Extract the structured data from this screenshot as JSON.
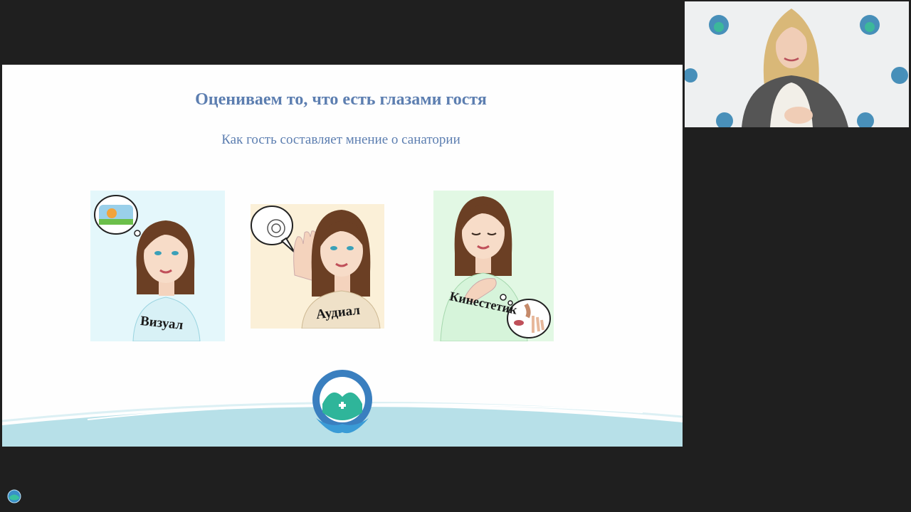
{
  "slide": {
    "title": "Оцениваем то, что есть глазами гостя",
    "subtitle": "Как гость составляет мнение о санатории",
    "cards": [
      {
        "label": "Визуал",
        "bg": "#e4f7fb"
      },
      {
        "label": "Аудиал",
        "bg": "#fbf0d8"
      },
      {
        "label": "Кинестетик",
        "bg": "#e2f8e4"
      }
    ]
  },
  "colors": {
    "title": "#5c7eb0",
    "wave": "#b7e0e8",
    "logo_ring": "#3a7fbf",
    "logo_green": "#2fb59a"
  },
  "icons": {
    "corner": "globe-icon",
    "logo": "association-logo-icon"
  }
}
